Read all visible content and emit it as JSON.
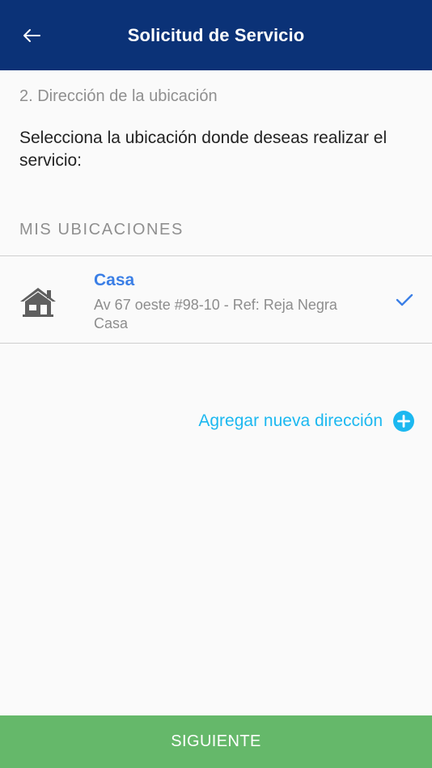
{
  "header": {
    "title": "Solicitud de Servicio",
    "back_icon": "arrow-left-icon"
  },
  "form": {
    "step_title": "2. Dirección de la ubicación",
    "instruction": "Selecciona la ubicación donde deseas realizar el servicio:",
    "section_label": "MIS UBICACIONES"
  },
  "locations": [
    {
      "name": "Casa",
      "address": "Av 67 oeste #98-10 - Ref: Reja Negra Casa",
      "icon": "home-icon",
      "selected": true
    }
  ],
  "add_address": {
    "label": "Agregar nueva dirección",
    "icon": "plus-circle-icon"
  },
  "footer": {
    "next_label": "SIGUIENTE"
  },
  "colors": {
    "header_bg": "#0b3277",
    "accent_blue": "#3b7fe6",
    "link_cyan": "#1cb8f0",
    "button_green": "#65b86a"
  }
}
